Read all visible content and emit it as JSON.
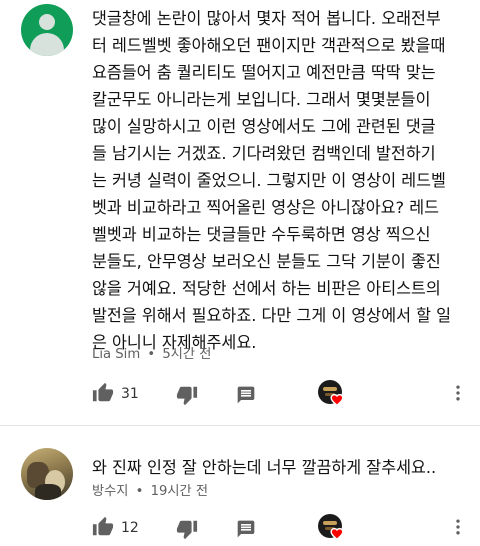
{
  "comments": [
    {
      "lines": [
        "댓글창에 논란이 많아서 몇자 적어 봅니다. 오래전부",
        "터 레드벨벳 좋아해오던 팬이지만 객관적으로 봤을때",
        "요즘들어 춤 퀄리티도 떨어지고 예전만큼 딱딱 맞는",
        "칼군무도 아니라는게 보입니다. 그래서 몇몇분들이",
        "많이 실망하시고 이런 영상에서도 그에 관련된 댓글",
        "들 남기시는 거겠죠. 기다려왔던 컴백인데 발전하기",
        "는 커녕 실력이 줄었으니. 그렇지만 이 영상이 레드벨",
        "벳과 비교하라고 찍어올린 영상은 아니잖아요? 레드",
        "벨벳과 비교하는 댓글들만 수두룩하면 영상 찍으신",
        "분들도, 안무영상 보러오신 분들도 그닥 기분이 좋진",
        "않을 거예요. 적당한 선에서 하는 비판은 아티스트의",
        "발전을 위해서 필요하죠. 다만 그게 이 영상에서 할 일",
        "은 아니니 자제해주세요."
      ],
      "author": "Lia Sim",
      "separator": "•",
      "time": "5시간 전",
      "like_count": "31"
    },
    {
      "lines": [
        "와 진짜 인정 잘 안하는데 너무 깔끔하게 잘추세요.."
      ],
      "author": "방수지",
      "separator": "•",
      "time": "19시간 전",
      "like_count": "12"
    }
  ],
  "colors": {
    "default_avatar": "#0f9d58",
    "heart": "#ff0000",
    "meta_text": "#606060",
    "icon": "#606060"
  },
  "icons": [
    "default-avatar-icon",
    "thumbs-up-icon",
    "thumbs-down-icon",
    "reply-icon",
    "creator-heart-icon",
    "more-vertical-icon"
  ]
}
